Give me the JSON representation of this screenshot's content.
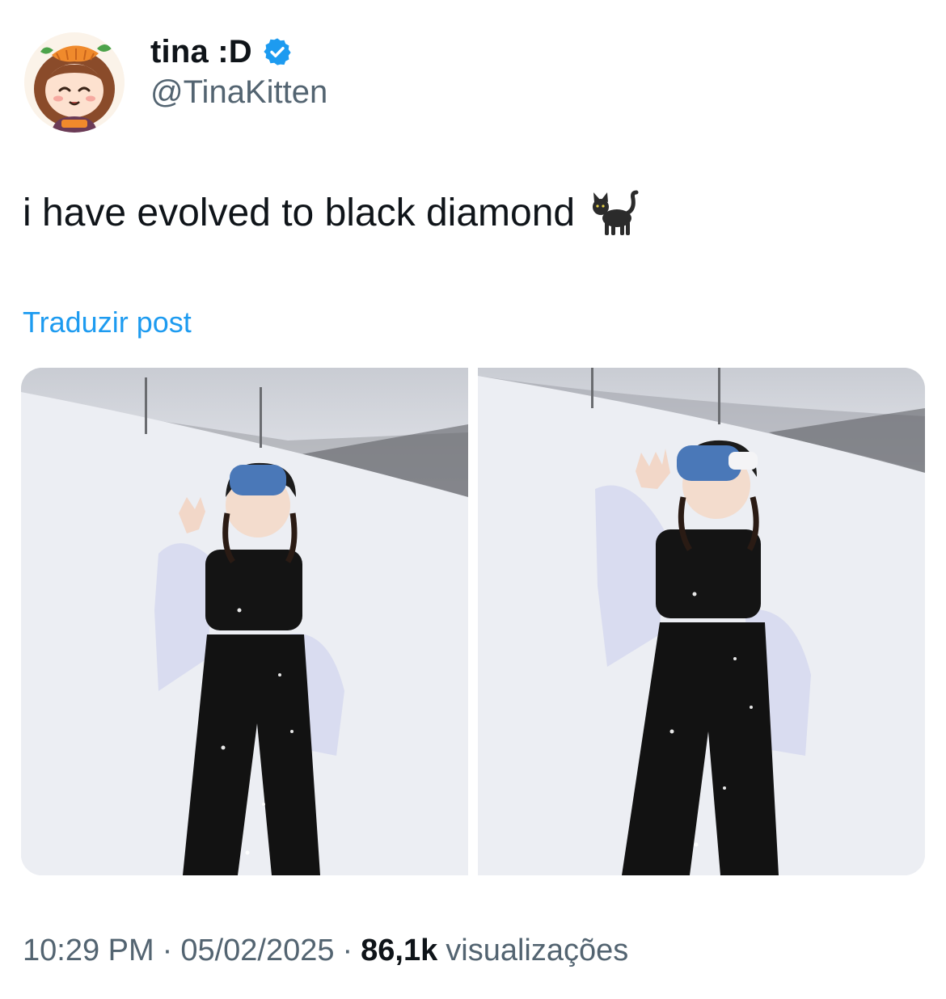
{
  "author": {
    "display_name": "tina :D",
    "handle": "@TinaKitten",
    "verified": true,
    "avatar_icon": "cartoon-girl-with-carrot-hat"
  },
  "post": {
    "text": "i have evolved to black diamond",
    "emoji": "black-cat-icon",
    "translate_label": "Traduzir post"
  },
  "media": [
    {
      "label": "snow-photo-peace-sign"
    },
    {
      "label": "snow-photo-wave"
    }
  ],
  "footer": {
    "time": "10:29 PM",
    "separator": "·",
    "date": "05/02/2025",
    "views_count": "86,1k",
    "views_label": "visualizações"
  },
  "colors": {
    "link": "#1d9bf0",
    "secondary_text": "#536471",
    "verified_badge": "#1d9bf0"
  }
}
